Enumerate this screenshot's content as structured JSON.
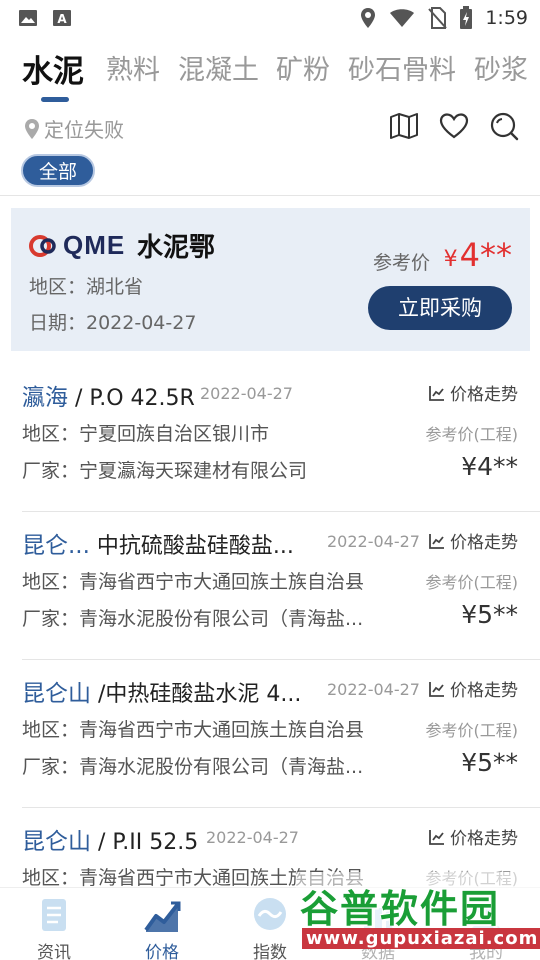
{
  "status_bar": {
    "time": "1:59"
  },
  "tabs": [
    {
      "label": "水泥"
    },
    {
      "label": "熟料"
    },
    {
      "label": "混凝土"
    },
    {
      "label": "矿粉"
    },
    {
      "label": "砂石骨料"
    },
    {
      "label": "砂浆"
    }
  ],
  "location": {
    "text": "定位失败"
  },
  "filter_chip": "全部",
  "banner": {
    "logo_text": "QME",
    "name": "水泥鄂",
    "region": "地区：湖北省",
    "date": "日期：2022-04-27",
    "price_label": "参考价",
    "currency": "¥",
    "price": "4**",
    "buy_button": "立即采购"
  },
  "items": [
    {
      "brand": "瀛海",
      "product": " / P.O 42.5R",
      "date": "2022-04-27",
      "trend": "价格走势",
      "region": "地区：宁夏回族自治区银川市",
      "price_label": "参考价(工程)",
      "maker": "厂家：宁夏瀛海天琛建材有限公司",
      "price": "¥4**"
    },
    {
      "brand": "昆仑...",
      "product": " 中抗硫酸盐硅酸盐...",
      "date": "2022-04-27",
      "trend": "价格走势",
      "region": "地区：青海省西宁市大通回族土族自治县",
      "price_label": "参考价(工程)",
      "maker": "厂家：青海水泥股份有限公司（青海盐...",
      "price": "¥5**"
    },
    {
      "brand": "昆仑山",
      "product": " /中热硅酸盐水泥  4...",
      "date": "2022-04-27",
      "trend": "价格走势",
      "region": "地区：青海省西宁市大通回族土族自治县",
      "price_label": "参考价(工程)",
      "maker": "厂家：青海水泥股份有限公司（青海盐...",
      "price": "¥5**"
    },
    {
      "brand": "昆仑山",
      "product": " / P.II 52.5",
      "date": "2022-04-27",
      "trend": "价格走势",
      "region": "地区：青海省西宁市大通回族土族自治县",
      "price_label": "参考价(工程)",
      "maker": "",
      "price": ""
    }
  ],
  "bottom_nav": [
    {
      "label": "资讯",
      "icon": "news-icon"
    },
    {
      "label": "价格",
      "icon": "chart-icon"
    },
    {
      "label": "指数",
      "icon": "index-icon"
    },
    {
      "label": "数据",
      "icon": "data-icon"
    },
    {
      "label": "我的",
      "icon": "profile-icon"
    }
  ],
  "watermark": {
    "title": "谷普软件园",
    "url": "www.gupuxiazai.com"
  },
  "colors": {
    "primary": "#2f5d9b",
    "button_dark": "#1f3f6f",
    "price_red": "#e23030",
    "banner_bg": "#e8eef6"
  }
}
